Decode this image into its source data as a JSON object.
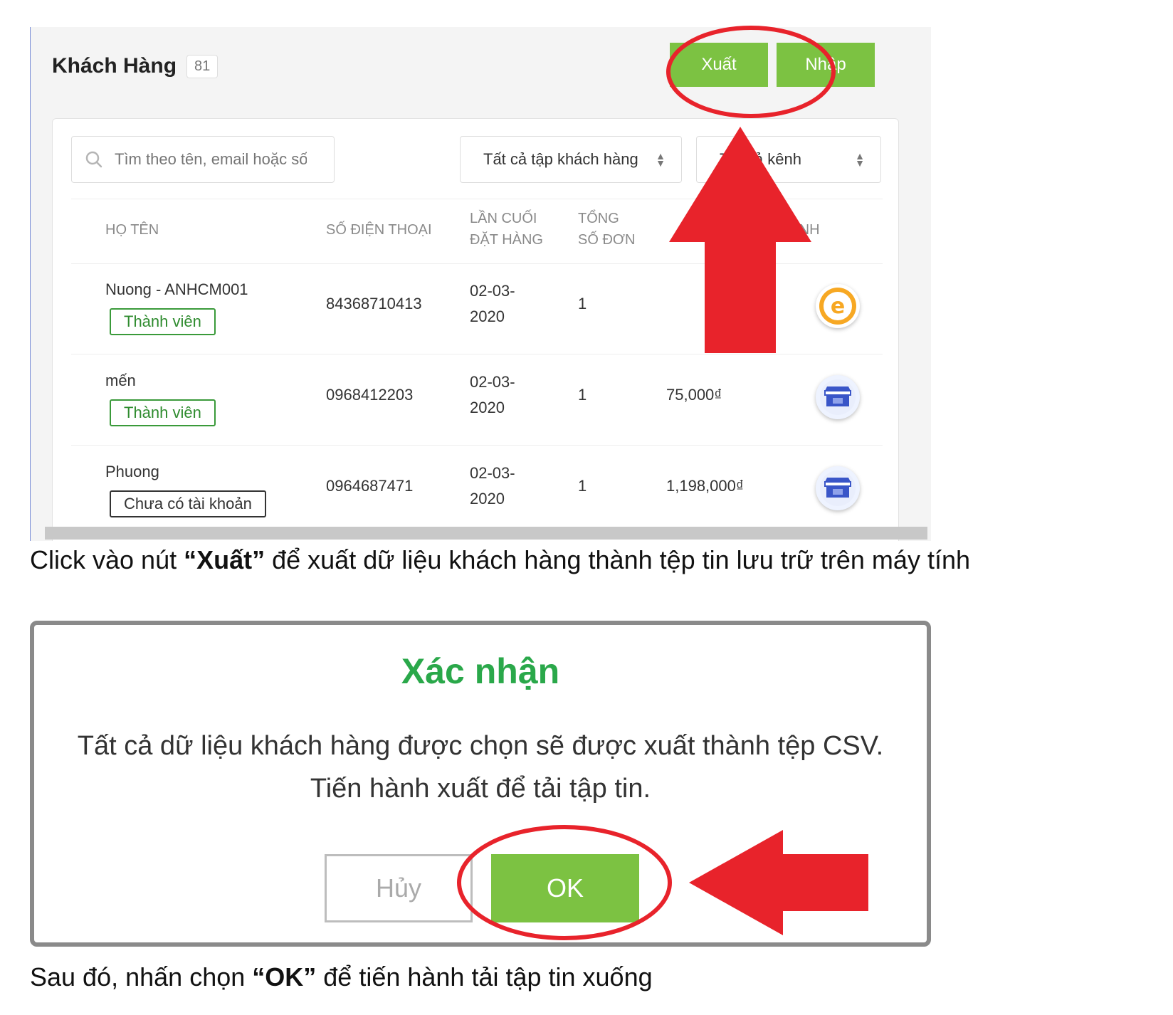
{
  "panel": {
    "title": "Khách Hàng",
    "count": "81",
    "export_label": "Xuất",
    "import_label": "Nhập",
    "search_placeholder": "Tìm theo tên, email hoặc số",
    "segment_filter": "Tất cả tập khách hàng",
    "channel_filter": "Tất cả kênh",
    "columns": {
      "name": "HỌ TÊN",
      "phone": "SỐ ĐIỆN THOẠI",
      "last_order_1": "LẦN CUỐI",
      "last_order_2": "ĐẶT HÀNG",
      "total_orders_1": "TỔNG",
      "total_orders_2": "SỐ ĐƠN",
      "channel": "KÊNH"
    },
    "rows": [
      {
        "name": "Nuong - ANHCM001",
        "tag": "Thành viên",
        "phone": "84368710413",
        "date_1": "02-03-",
        "date_2": "2020",
        "orders": "1",
        "total": "",
        "channel_icon": "ecommerce-e-icon"
      },
      {
        "name": "mến",
        "tag": "Thành viên",
        "phone": "0968412203",
        "date_1": "02-03-",
        "date_2": "2020",
        "orders": "1",
        "total": "75,000₫",
        "channel_icon": "storefront-icon"
      },
      {
        "name": "Phuong",
        "tag": "Chưa có tài khoản",
        "phone": "0964687471",
        "date_1": "02-03-",
        "date_2": "2020",
        "orders": "1",
        "total": "1,198,000₫",
        "channel_icon": "storefront-icon"
      }
    ]
  },
  "caption1": {
    "pre": "Click vào nút ",
    "bold": "“Xuất”",
    "post": "  để xuất dữ liệu khách hàng thành tệp tin lưu trữ trên máy tính"
  },
  "dialog": {
    "title": "Xác nhận",
    "message": "Tất cả dữ liệu khách hàng được chọn sẽ được xuất thành tệp CSV. Tiến hành xuất để tải tập tin.",
    "cancel_label": "Hủy",
    "ok_label": "OK"
  },
  "caption2": {
    "pre": "Sau đó, nhấn chọn ",
    "bold": "“OK”",
    "post": " để tiến hành tải tập tin xuống"
  },
  "colors": {
    "brand_green": "#7cc242",
    "title_green": "#2aa84a",
    "annotation_red": "#e8232b"
  }
}
